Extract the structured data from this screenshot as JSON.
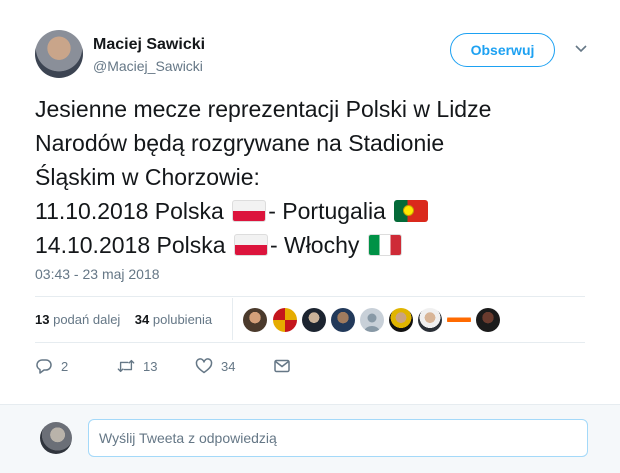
{
  "author": {
    "name": "Maciej Sawicki",
    "handle": "@Maciej_Sawicki"
  },
  "follow_button": {
    "label": "Obserwuj"
  },
  "more_menu": {
    "icon": "chevron-down-icon"
  },
  "tweet": {
    "line1": "Jesienne mecze reprezentacji Polski w Lidze",
    "line2": "Narodów będą rozgrywane na Stadionie",
    "line3": "Śląskim w Chorzowie:",
    "match1_date_team": "11.10.2018  Polska",
    "match1_opponent": "- Portugalia",
    "match2_date_team": "14.10.2018 Polska",
    "match2_opponent": "- Włochy",
    "flags": [
      "poland-flag",
      "portugal-flag",
      "poland-flag",
      "italy-flag"
    ]
  },
  "timestamp": "03:43 - 23 maj 2018",
  "stats": {
    "retweets_count": "13",
    "retweets_label": "podań dalej",
    "likes_count": "34",
    "likes_label": "polubienia"
  },
  "liker_avatars": [
    "avatar-1",
    "avatar-2",
    "avatar-3",
    "avatar-4",
    "avatar-5",
    "avatar-6",
    "avatar-7",
    "avatar-8",
    "avatar-9"
  ],
  "actions": {
    "reply_count": "2",
    "retweet_count": "13",
    "like_count": "34"
  },
  "reply_box": {
    "placeholder": "Wyślij Tweeta z odpowiedzią"
  },
  "colors": {
    "accent": "#1da1f2",
    "muted": "#657786",
    "text": "#14171a"
  }
}
